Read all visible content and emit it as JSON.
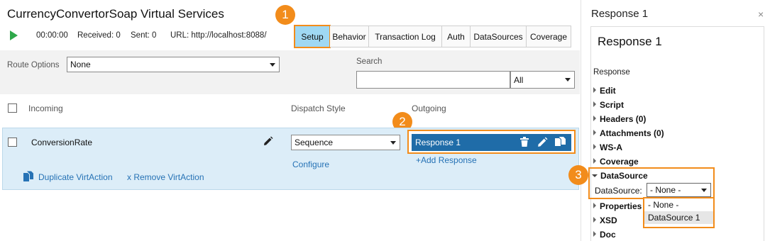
{
  "title": "CurrencyConvertorSoap Virtual Services",
  "status": {
    "time": "00:00:00",
    "received": "Received: 0",
    "sent": "Sent: 0",
    "url": "URL: http://localhost:8088/"
  },
  "tabs": [
    "Setup",
    "Behavior",
    "Transaction Log",
    "Auth",
    "DataSources",
    "Coverage"
  ],
  "route_options": {
    "label": "Route Options",
    "value": "None"
  },
  "search": {
    "label": "Search",
    "value": "",
    "filter": "All"
  },
  "table": {
    "headers": {
      "incoming": "Incoming",
      "dispatch": "Dispatch Style",
      "outgoing": "Outgoing"
    },
    "row": {
      "incoming": "ConversionRate",
      "dispatch": "Sequence",
      "configure": "Configure",
      "response": "Response 1",
      "add_response": "+Add Response",
      "duplicate": "Duplicate VirtAction",
      "remove": "x Remove VirtAction"
    }
  },
  "badges": [
    "1",
    "2",
    "3"
  ],
  "panel": {
    "title": "Response 1",
    "close": "×",
    "heading": "Response 1",
    "section": "Response",
    "items_top": [
      "Edit",
      "Script",
      "Headers (0)",
      "Attachments (0)",
      "WS-A",
      "Coverage"
    ],
    "datasource_item": "DataSource",
    "datasource_label": "DataSource:",
    "datasource_value": "- None -",
    "datasource_options": [
      "- None -",
      "DataSource 1"
    ],
    "items_bottom": [
      "Properties",
      "XSD",
      "Doc"
    ]
  },
  "colors": {
    "accent": "#f28c1b",
    "selected_tab": "#9fd8f3",
    "response_bar": "#1f6ca8",
    "link": "#2672b5",
    "play": "#2ea84a"
  }
}
